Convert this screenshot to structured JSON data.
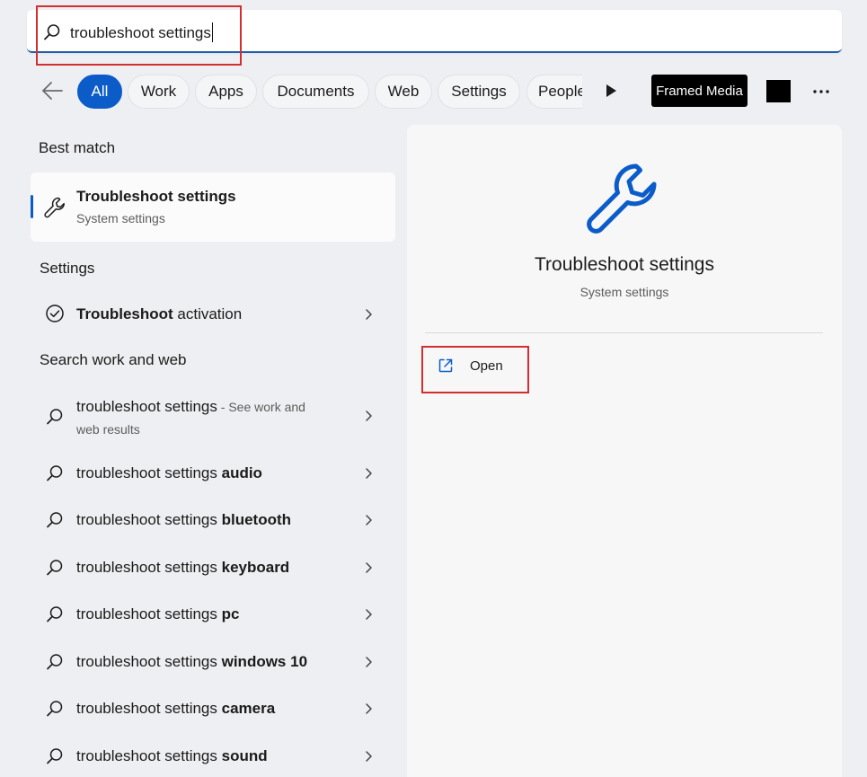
{
  "search": {
    "query": "troubleshoot settings",
    "icon": "search-icon"
  },
  "filters": {
    "back_icon": "arrow-left-icon",
    "chips": [
      "All",
      "Work",
      "Apps",
      "Documents",
      "Web",
      "Settings",
      "People"
    ],
    "active": "All",
    "more_icon": "play-icon",
    "framed_media": "Framed Media",
    "overflow_icon": "ellipsis-icon"
  },
  "best_match": {
    "heading": "Best match",
    "title": "Troubleshoot settings",
    "subtitle": "System settings",
    "icon": "wrench-icon"
  },
  "settings": {
    "heading": "Settings",
    "items": [
      {
        "bold": "Troubleshoot",
        "rest": " activation"
      }
    ]
  },
  "web": {
    "heading": "Search work and web",
    "first": {
      "text": "troubleshoot settings",
      "hint_line1": " - See work and",
      "hint_line2": "web results"
    },
    "items": [
      {
        "prefix": "troubleshoot settings ",
        "bold": "audio"
      },
      {
        "prefix": "troubleshoot settings ",
        "bold": "bluetooth"
      },
      {
        "prefix": "troubleshoot settings ",
        "bold": "keyboard"
      },
      {
        "prefix": "troubleshoot settings ",
        "bold": "pc"
      },
      {
        "prefix": "troubleshoot settings ",
        "bold": "windows 10"
      },
      {
        "prefix": "troubleshoot settings ",
        "bold": "camera"
      },
      {
        "prefix": "troubleshoot settings ",
        "bold": "sound"
      }
    ]
  },
  "detail": {
    "title": "Troubleshoot settings",
    "subtitle": "System settings",
    "open_label": "Open",
    "icon": "wrench-icon",
    "open_icon": "open-external-icon"
  },
  "colors": {
    "accent": "#0b5cc9",
    "highlight_box": "#d32f2f"
  }
}
